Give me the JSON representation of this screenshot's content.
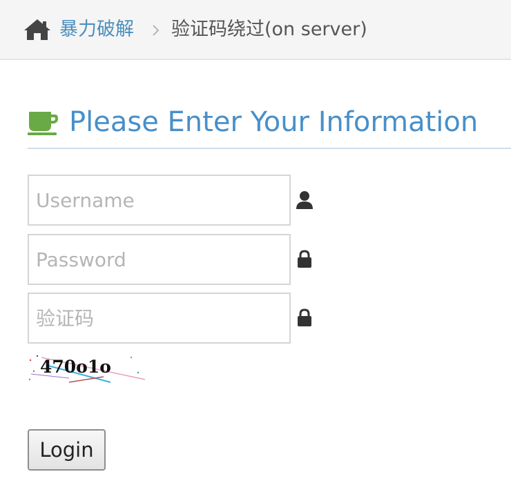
{
  "breadcrumb": {
    "home_icon": "home-icon",
    "link_label": "暴力破解",
    "separator_icon": "chevron-right-icon",
    "current_label": "验证码绕过(on server)"
  },
  "header": {
    "icon": "coffee-icon",
    "title": "Please Enter Your Information",
    "accent_color": "#478fca",
    "icon_color": "#69aa46"
  },
  "form": {
    "username": {
      "placeholder": "Username",
      "value": "",
      "icon": "user-icon"
    },
    "password": {
      "placeholder": "Password",
      "value": "",
      "icon": "lock-icon"
    },
    "captcha_input": {
      "placeholder": "验证码",
      "value": "",
      "icon": "lock-icon"
    },
    "captcha_image_text": "470o1o",
    "login_label": "Login"
  }
}
